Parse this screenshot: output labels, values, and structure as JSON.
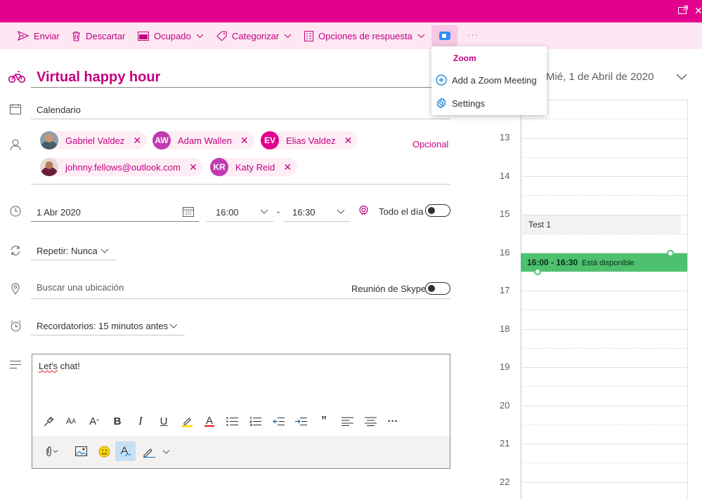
{
  "window": {
    "popout_icon": "popout-icon",
    "close_glyph": "✕"
  },
  "toolbar": {
    "send": "Enviar",
    "discard": "Descartar",
    "busy": "Ocupado",
    "categorize": "Categorizar",
    "response_options": "Opciones de respuesta",
    "more": "···"
  },
  "zoom_menu": {
    "header": "Zoom",
    "add_meeting": "Add a Zoom Meeting",
    "settings": "Settings"
  },
  "form": {
    "title": "Virtual happy hour",
    "calendar": "Calendario",
    "optional_link": "Opcional",
    "attendees": [
      {
        "name": "Gabriel Valdez",
        "initials": "",
        "color": "#8aa0a8"
      },
      {
        "name": "Adam Wallen",
        "initials": "AW",
        "color": "#c239b3"
      },
      {
        "name": "Elias Valdez",
        "initials": "EV",
        "color": "#e3008c"
      },
      {
        "name": "johnny.fellows@outlook.com",
        "initials": "",
        "color": "#e7d7d0"
      },
      {
        "name": "Katy Reid",
        "initials": "KR",
        "color": "#c239b3"
      }
    ],
    "date": "1 Abr 2020",
    "start_time": "16:00",
    "time_separator": "-",
    "end_time": "16:30",
    "all_day_label": "Todo el día",
    "repeat": "Repetir: Nunca",
    "location_placeholder": "Buscar una ubicación",
    "skype_label": "Reunión de Skype",
    "reminder": "Recordatorios: 15 minutos antes",
    "body_text_misspelled": "Let's",
    "body_text_rest": " chat!"
  },
  "calendar": {
    "date_header": "Mié, 1 de Abril de 2020",
    "hours": [
      "13",
      "14",
      "15",
      "16",
      "17",
      "18",
      "19",
      "20",
      "21",
      "22"
    ],
    "existing_event": "Test 1",
    "new_event_time": "16:00 - 16:30",
    "new_event_status": "Está disponible",
    "event_color": "#4ec16f"
  },
  "colors": {
    "accent": "#e3008c",
    "accent_text": "#c30080",
    "toolbar_bg": "#fde7f3"
  }
}
